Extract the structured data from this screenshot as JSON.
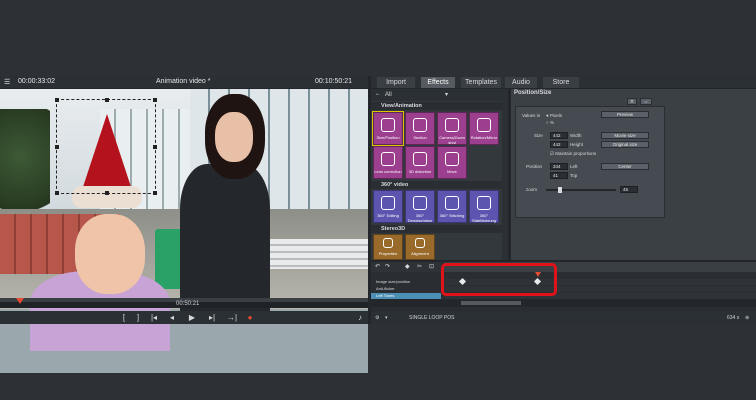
{
  "monitor": {
    "timecode_left": "00:00:33:02",
    "title": "Animation video *",
    "timecode_right": "00:10:50:21",
    "playhead_time": "00:50:21",
    "transport": [
      "[",
      "]",
      "|◂",
      "◂",
      "▶",
      "▸|",
      "→|"
    ]
  },
  "tabs": [
    {
      "label": "Import"
    },
    {
      "label": "Effects"
    },
    {
      "label": "Templates"
    },
    {
      "label": "Audio"
    },
    {
      "label": "Store"
    }
  ],
  "effects": {
    "filter_all": "All",
    "sections": [
      "View/Animation",
      "360° video",
      "Stereo3D"
    ],
    "view_animation": [
      "Size/Position",
      "Section",
      "Camera/Zoom shot",
      "Rotation/Mirror",
      "Lens correction",
      "3D distortion",
      "Move"
    ],
    "video360": [
      "360° Editing",
      "360° Denoise/ation",
      "360° Stitching",
      "360° Stabilisierung"
    ],
    "stereo3d": [
      "Properties",
      "Alignment"
    ]
  },
  "position_size": {
    "title": "Position/Size",
    "values_in_label": "Values in",
    "unit_option": "Pixels",
    "unit_option2": "%",
    "preview_button": "Preview",
    "size_label": "Size",
    "width_value": "442",
    "width_label": "Width",
    "height_value": "442",
    "height_label": "Height",
    "movie_size_button": "Movie size",
    "original_size_button": "Original size",
    "maintain_proportions": "Maintain proportions",
    "position_label": "Position",
    "left_value": "344",
    "left_label": "Left",
    "top_value": "41",
    "top_label": "Top",
    "center_button": "Center",
    "zoom_label": "zoom",
    "zoom_value": "45"
  },
  "timeline": {
    "rows": [
      "Image size/position",
      "Anti-flicker",
      "Left Tones"
    ],
    "status_left": "SINGLE LOOP POS",
    "status_right": "634 s"
  }
}
